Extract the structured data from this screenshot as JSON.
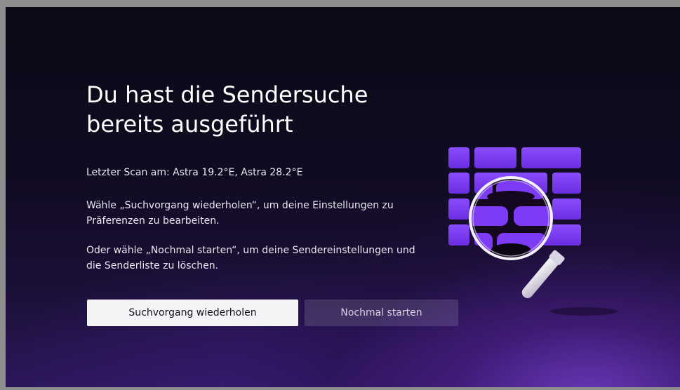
{
  "dialog": {
    "title": "Du hast die Sendersuche bereits ausgeführt",
    "last_scan": "Letzter Scan am: Astra 19.2°E, Astra 28.2°E",
    "info_repeat": "Wähle „Suchvorgang wiederholen“, um deine Einstellungen zu Präferenzen zu bearbeiten.",
    "info_restart": "Oder wähle „Nochmal starten“, um deine Sendereinstellungen und die Senderliste zu löschen."
  },
  "buttons": {
    "repeat_label": "Suchvorgang wiederholen",
    "restart_label": "Nochmal starten"
  },
  "illustration": {
    "icon": "channel-search-magnifier-icon"
  },
  "colors": {
    "accent": "#7b3cf0",
    "background": "#0c0a16",
    "primary_button": "#f4f3f6"
  }
}
